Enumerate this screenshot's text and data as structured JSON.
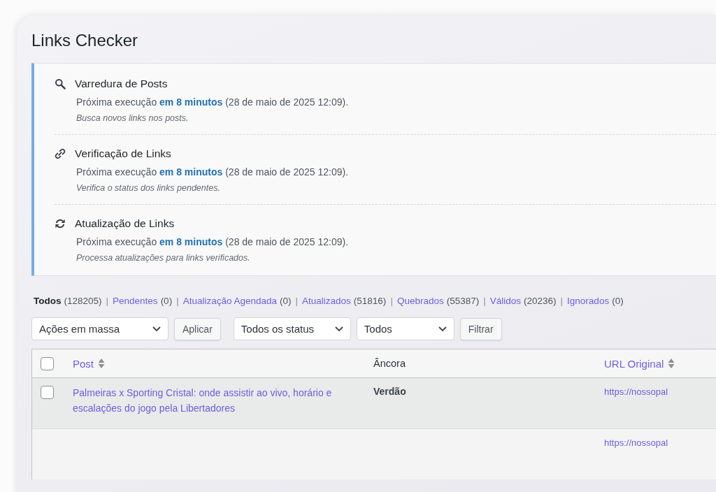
{
  "page": {
    "title": "Links Checker"
  },
  "notice": {
    "tasks": [
      {
        "kind": "search",
        "title": "Varredura de Posts",
        "next_run": {
          "prefix": "Próxima execução",
          "link": "em 8 minutos",
          "suffix": "(28 de maio de 2025 12:09)."
        },
        "description": "Busca novos links nos posts."
      },
      {
        "kind": "link",
        "title": "Verificação de Links",
        "next_run": {
          "prefix": "Próxima execução",
          "link": "em 8 minutos",
          "suffix": "(28 de maio de 2025 12:09)."
        },
        "description": "Verifica o status dos links pendentes."
      },
      {
        "kind": "refresh",
        "title": "Atualização de Links",
        "next_run": {
          "prefix": "Próxima execução",
          "link": "em 8 minutos",
          "suffix": "(28 de maio de 2025 12:09)."
        },
        "description": "Processa atualizações para links verificados."
      }
    ]
  },
  "status_filters": {
    "separator": "|",
    "items": [
      {
        "label": "Todos",
        "count": "(128205)",
        "selected": true
      },
      {
        "label": "Pendentes",
        "count": "(0)",
        "selected": false
      },
      {
        "label": "Atualização Agendada",
        "count": "(0)",
        "selected": false
      },
      {
        "label": "Atualizados",
        "count": "(51816)",
        "selected": false
      },
      {
        "label": "Quebrados",
        "count": "(55387)",
        "selected": false
      },
      {
        "label": "Válidos",
        "count": "(20236)",
        "selected": false
      },
      {
        "label": "Ignorados",
        "count": "(0)",
        "selected": false
      }
    ]
  },
  "toolbar": {
    "bulk_actions": {
      "value": "Ações em massa"
    },
    "apply_button": "Aplicar",
    "status_select": {
      "value": "Todos os status"
    },
    "type_select": {
      "value": "Todos"
    },
    "filter_button": "Filtrar"
  },
  "table": {
    "columns": [
      {
        "kind": "checkbox",
        "checked": false
      },
      {
        "kind": "sortable",
        "label": "Post"
      },
      {
        "kind": "plain",
        "label": "Âncora"
      },
      {
        "kind": "sortable",
        "label": "URL Original"
      }
    ],
    "rows": [
      {
        "checked": false,
        "post": "Palmeiras x Sporting Cristal: onde assistir ao vivo, horário e escalações do jogo pela Libertadores",
        "anchor": "Verdão",
        "url": "https://nossopal"
      },
      {
        "url": "https://nossopal"
      }
    ]
  }
}
